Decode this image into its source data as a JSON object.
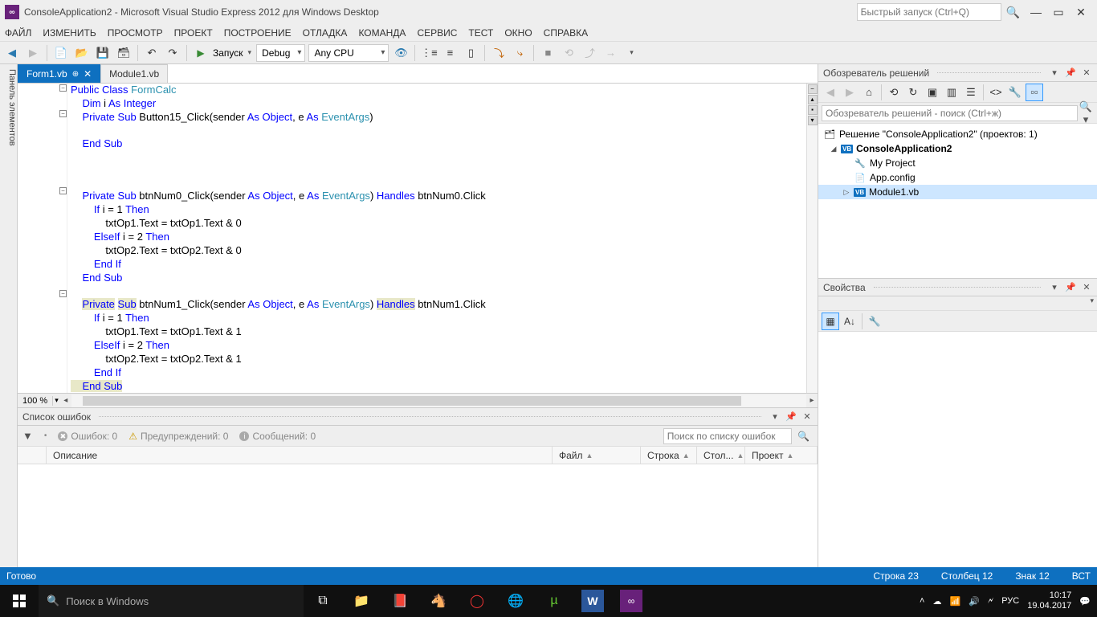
{
  "title": "ConsoleApplication2 - Microsoft Visual Studio Express 2012 для Windows Desktop",
  "quick_launch_placeholder": "Быстрый запуск (Ctrl+Q)",
  "menu": [
    "ФАЙЛ",
    "ИЗМЕНИТЬ",
    "ПРОСМОТР",
    "ПРОЕКТ",
    "ПОСТРОЕНИЕ",
    "ОТЛАДКА",
    "КОМАНДА",
    "СЕРВИС",
    "ТЕСТ",
    "ОКНО",
    "СПРАВКА"
  ],
  "toolbar": {
    "start_label": "Запуск",
    "config": "Debug",
    "platform": "Any CPU"
  },
  "toolbox_label": "Панель элементов",
  "tabs": [
    {
      "label": "Form1.vb",
      "active": true,
      "pinned": true
    },
    {
      "label": "Module1.vb",
      "active": false,
      "pinned": false
    }
  ],
  "zoom": "100 %",
  "error_list": {
    "title": "Список ошибок",
    "errors": "Ошибок: 0",
    "warnings": "Предупреждений: 0",
    "messages": "Сообщений: 0",
    "search_placeholder": "Поиск по списку ошибок",
    "cols": {
      "desc": "Описание",
      "file": "Файл",
      "line": "Строка",
      "col": "Стол...",
      "proj": "Проект"
    }
  },
  "solution_explorer": {
    "title": "Обозреватель решений",
    "search_placeholder": "Обозреватель решений - поиск (Ctrl+ж)",
    "solution": "Решение \"ConsoleApplication2\"  (проектов: 1)",
    "project": "ConsoleApplication2",
    "nodes": [
      "My Project",
      "App.config",
      "Module1.vb"
    ]
  },
  "properties": {
    "title": "Свойства"
  },
  "status": {
    "ready": "Готово",
    "line": "Строка 23",
    "col": "Столбец 12",
    "char": "Знак 12",
    "ins": "ВСТ"
  },
  "taskbar": {
    "search_placeholder": "Поиск в Windows",
    "lang": "РУС",
    "time": "10:17",
    "date": "19.04.2017"
  },
  "code": {
    "l1a": "Public",
    "l1b": " Class ",
    "l1c": "FormCalc",
    "l2a": "    ",
    "l2b": "Dim",
    "l2c": " i ",
    "l2d": "As",
    "l2e": " Integer",
    "l3a": "    ",
    "l3b": "Private",
    "l3c": " ",
    "l3d": "Sub",
    "l3e": " Button15_Click(sender ",
    "l3f": "As",
    "l3g": " ",
    "l3h": "Object",
    "l3i": ", e ",
    "l3j": "As",
    "l3k": " ",
    "l3l": "EventArgs",
    ")": "",
    "l3m": ")",
    "l5a": "    ",
    "l5b": "End",
    "l5c": " ",
    "l5d": "Sub",
    "l9a": "    ",
    "l9b": "Private",
    "l9c": " ",
    "l9d": "Sub",
    "l9e": " btnNum0_Click(sender ",
    "l9f": "As",
    "l9g": " ",
    "l9h": "Object",
    "l9i": ", e ",
    "l9j": "As",
    "l9k": " ",
    "l9l": "EventArgs",
    "l9m": ") ",
    "l9n": "Handles",
    "l9o": " btnNum0.Click",
    "l10a": "        ",
    "l10b": "If",
    "l10c": " i = 1 ",
    "l10d": "Then",
    "l11": "            txtOp1.Text = txtOp1.Text & 0",
    "l12a": "        ",
    "l12b": "ElseIf",
    "l12c": " i = 2 ",
    "l12d": "Then",
    "l13": "            txtOp2.Text = txtOp2.Text & 0",
    "l14a": "        ",
    "l14b": "End",
    "l14c": " ",
    "l14d": "If",
    "l15a": "    ",
    "l15b": "End",
    "l15c": " ",
    "l15d": "Sub",
    "l17a": "    ",
    "l17b": "Private",
    "l17c": " ",
    "l17d": "Sub",
    "l17e": " btnNum1_Click(sender ",
    "l17f": "As",
    "l17g": " ",
    "l17h": "Object",
    "l17i": ", e ",
    "l17j": "As",
    "l17k": " ",
    "l17l": "EventArgs",
    "l17m": ") ",
    "l17n": "Handles",
    "l17o": " btnNum1.Click",
    "l18a": "        ",
    "l18b": "If",
    "l18c": " i = 1 ",
    "l18d": "Then",
    "l19": "            txtOp1.Text = txtOp1.Text & 1",
    "l20a": "        ",
    "l20b": "ElseIf",
    "l20c": " i = 2 ",
    "l20d": "Then",
    "l21": "            txtOp2.Text = txtOp2.Text & 1",
    "l22a": "        ",
    "l22b": "End",
    "l22c": " ",
    "l22d": "If",
    "l23a": "    ",
    "l23b": "End",
    "l23c": " ",
    "l23d": "Sub"
  }
}
